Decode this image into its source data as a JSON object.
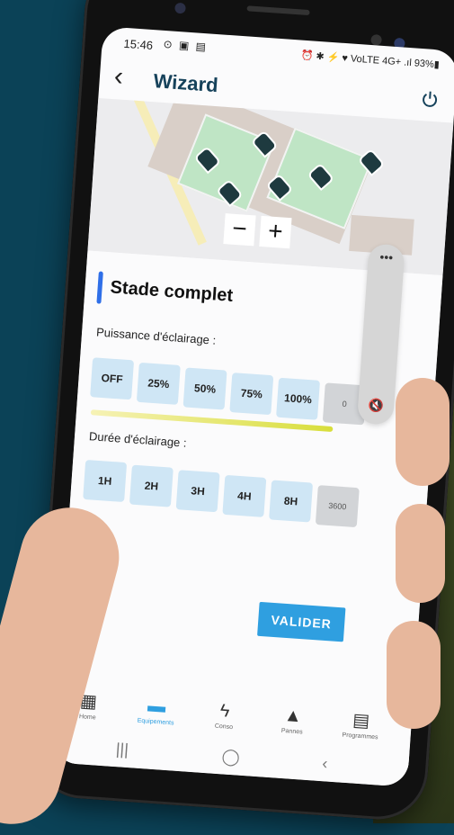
{
  "status": {
    "time": "15:46",
    "icons": "⊙ ▣ ▤",
    "right": "⏰ ✱ ⚡ ♥ VoLTE 4G+ .ıl 93%▮"
  },
  "header": {
    "title": "Wizard",
    "back": "‹",
    "power": "⏻"
  },
  "map": {
    "zoom_out": "−",
    "zoom_in": "+"
  },
  "section": {
    "title": "Stade complet"
  },
  "power": {
    "label": "Puissance d'éclairage :",
    "options": [
      "OFF",
      "25%",
      "50%",
      "75%",
      "100%",
      "0"
    ]
  },
  "duration": {
    "label": "Durée d'éclairage :",
    "options": [
      "1H",
      "2H",
      "3H",
      "4H",
      "8H",
      "3600"
    ]
  },
  "actions": {
    "validate": "VALIDER"
  },
  "volume": {
    "more": "•••",
    "mute": "🔇"
  },
  "nav": [
    {
      "label": "Home",
      "icon": "▦"
    },
    {
      "label": "Equipements",
      "icon": "▬"
    },
    {
      "label": "Conso",
      "icon": "ϟ"
    },
    {
      "label": "Pannes",
      "icon": "▲"
    },
    {
      "label": "Programmes",
      "icon": "▤"
    }
  ],
  "sysnav": {
    "recent": "|||",
    "home": "◯",
    "back": "‹"
  },
  "colors": {
    "accent": "#2f9fe0",
    "title": "#16425b",
    "option_bg": "#cfe6f5",
    "section_bar": "#2f6fe8"
  }
}
